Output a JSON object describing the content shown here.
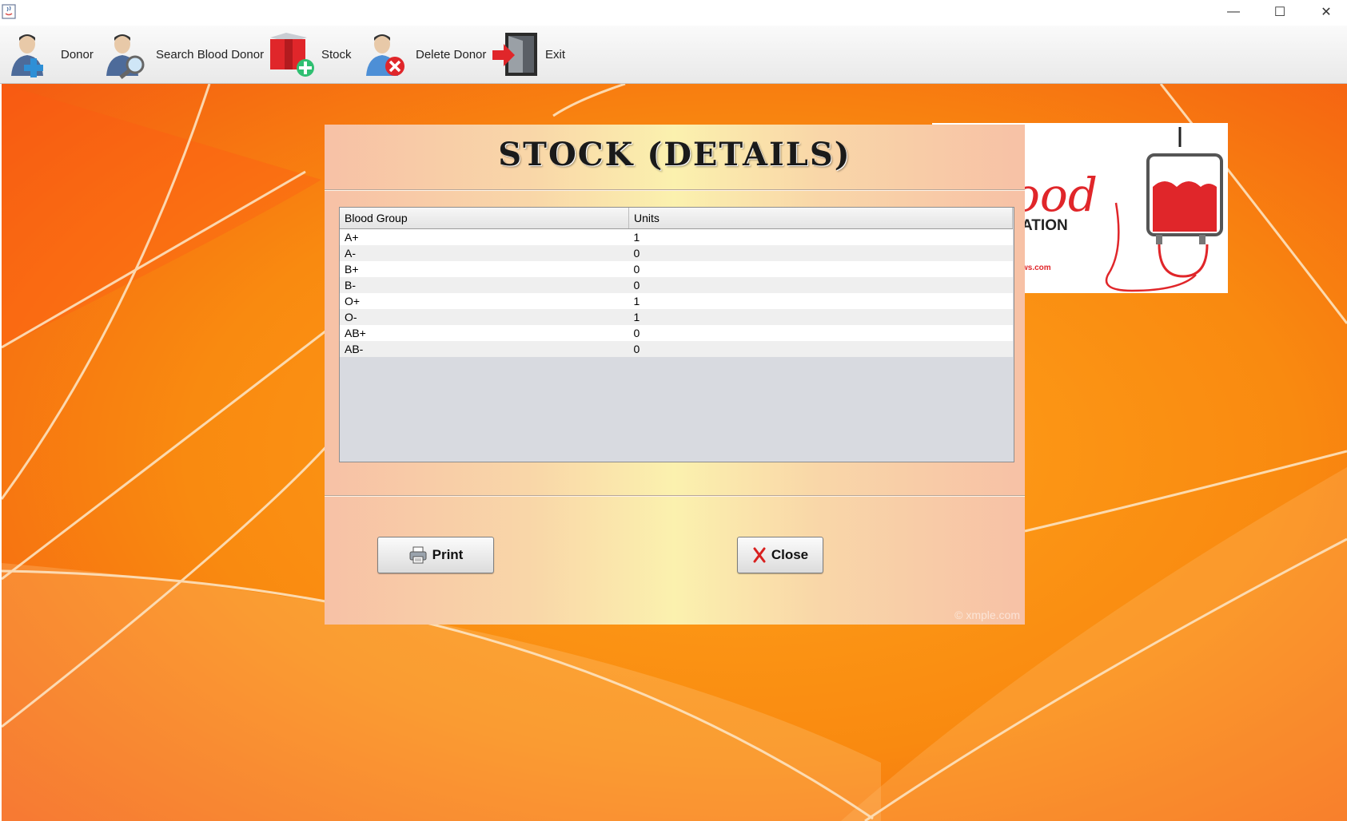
{
  "window": {
    "minimize_glyph": "—",
    "maximize_glyph": "☐",
    "close_glyph": "✕"
  },
  "toolbar": {
    "items": [
      {
        "label": "Donor",
        "icon": "add-user-icon"
      },
      {
        "label": "Search Blood Donor",
        "icon": "search-user-icon"
      },
      {
        "label": "Stock",
        "icon": "stock-box-icon"
      },
      {
        "label": "Delete Donor",
        "icon": "delete-user-icon"
      },
      {
        "label": "Exit",
        "icon": "exit-door-icon"
      }
    ]
  },
  "logo": {
    "text_top": "ood",
    "text_bottom": "ATION",
    "text_url": "ws.com"
  },
  "panel": {
    "title": "STOCK (DETAILS)",
    "table": {
      "headers": [
        "Blood Group",
        "Units"
      ],
      "rows": [
        [
          "A+",
          "1"
        ],
        [
          "A-",
          "0"
        ],
        [
          "B+",
          "0"
        ],
        [
          "B-",
          "0"
        ],
        [
          "O+",
          "1"
        ],
        [
          "O-",
          "1"
        ],
        [
          "AB+",
          "0"
        ],
        [
          "AB-",
          "0"
        ]
      ]
    },
    "print_label": "Print",
    "close_label": "Close",
    "watermark": "© xmple.com"
  },
  "colors": {
    "accent_red": "#e0262a",
    "desktop_orange": "#f57c00"
  }
}
